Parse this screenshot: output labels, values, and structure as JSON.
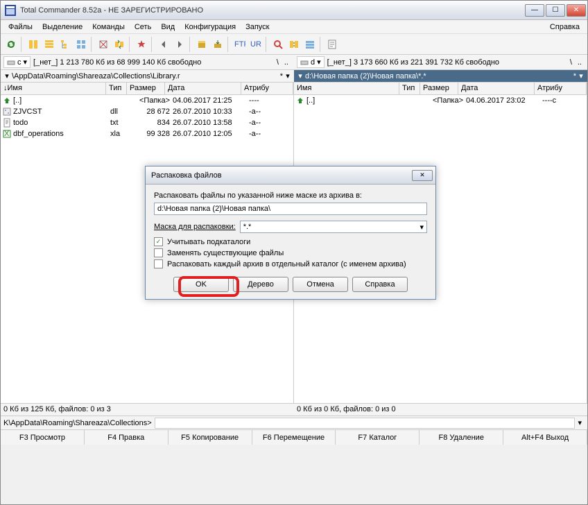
{
  "window": {
    "title": "Total Commander 8.52a - НЕ ЗАРЕГИСТРИРОВАНО"
  },
  "menu": {
    "file": "Файлы",
    "select": "Выделение",
    "commands": "Команды",
    "net": "Сеть",
    "view": "Вид",
    "config": "Конфигурация",
    "start": "Запуск",
    "help": "Справка"
  },
  "drives": {
    "left": {
      "letter": "c",
      "label": "[_нет_]",
      "info": "1 213 780 Кб из 68 999 140 Кб свободно"
    },
    "right": {
      "letter": "d",
      "label": "[_нет_]",
      "info": "3 173 660 Кб из 221 391 732 Кб свободно"
    }
  },
  "paths": {
    "left": "\\AppData\\Roaming\\Shareaza\\Collections\\Library.r",
    "right": "d:\\Новая папка (2)\\Новая папка\\*.*"
  },
  "columns": {
    "name": "Имя",
    "ext": "Тип",
    "size": "Размер",
    "date": "Дата",
    "attr": "Атрибу"
  },
  "files_left": [
    {
      "name": "[..]",
      "ext": "",
      "size": "<Папка>",
      "date": "04.06.2017 21:25",
      "attr": "----"
    },
    {
      "name": "ZJVCST",
      "ext": "dll",
      "size": "28 672",
      "date": "26.07.2010 10:33",
      "attr": "-a--"
    },
    {
      "name": "todo",
      "ext": "txt",
      "size": "834",
      "date": "26.07.2010 13:58",
      "attr": "-a--"
    },
    {
      "name": "dbf_operations",
      "ext": "xla",
      "size": "99 328",
      "date": "26.07.2010 12:05",
      "attr": "-a--"
    }
  ],
  "files_right": [
    {
      "name": "[..]",
      "ext": "",
      "size": "<Папка>",
      "date": "04.06.2017 23:02",
      "attr": "----c"
    }
  ],
  "status": {
    "left": "0 Кб из 125 Кб, файлов: 0 из 3",
    "right": "0 Кб из 0 Кб, файлов: 0 из 0"
  },
  "cmdline": "K\\AppData\\Roaming\\Shareaza\\Collections>",
  "fkeys": {
    "f3": "F3 Просмотр",
    "f4": "F4 Правка",
    "f5": "F5 Копирование",
    "f6": "F6 Перемещение",
    "f7": "F7 Каталог",
    "f8": "F8 Удаление",
    "altf4": "Alt+F4 Выход"
  },
  "dialog": {
    "title": "Распаковка файлов",
    "prompt": "Распаковать файлы по указанной ниже маске из архива в:",
    "dest": "d:\\Новая папка (2)\\Новая папка\\",
    "mask_label": "Маска для распаковки:",
    "mask_value": "*.*",
    "chk1": "Учитывать подкаталоги",
    "chk2": "Заменять существующие файлы",
    "chk3": "Распаковать каждый архив в отдельный каталог (с именем архива)",
    "ok": "OK",
    "tree": "Дерево",
    "cancel": "Отмена",
    "help": "Справка"
  }
}
